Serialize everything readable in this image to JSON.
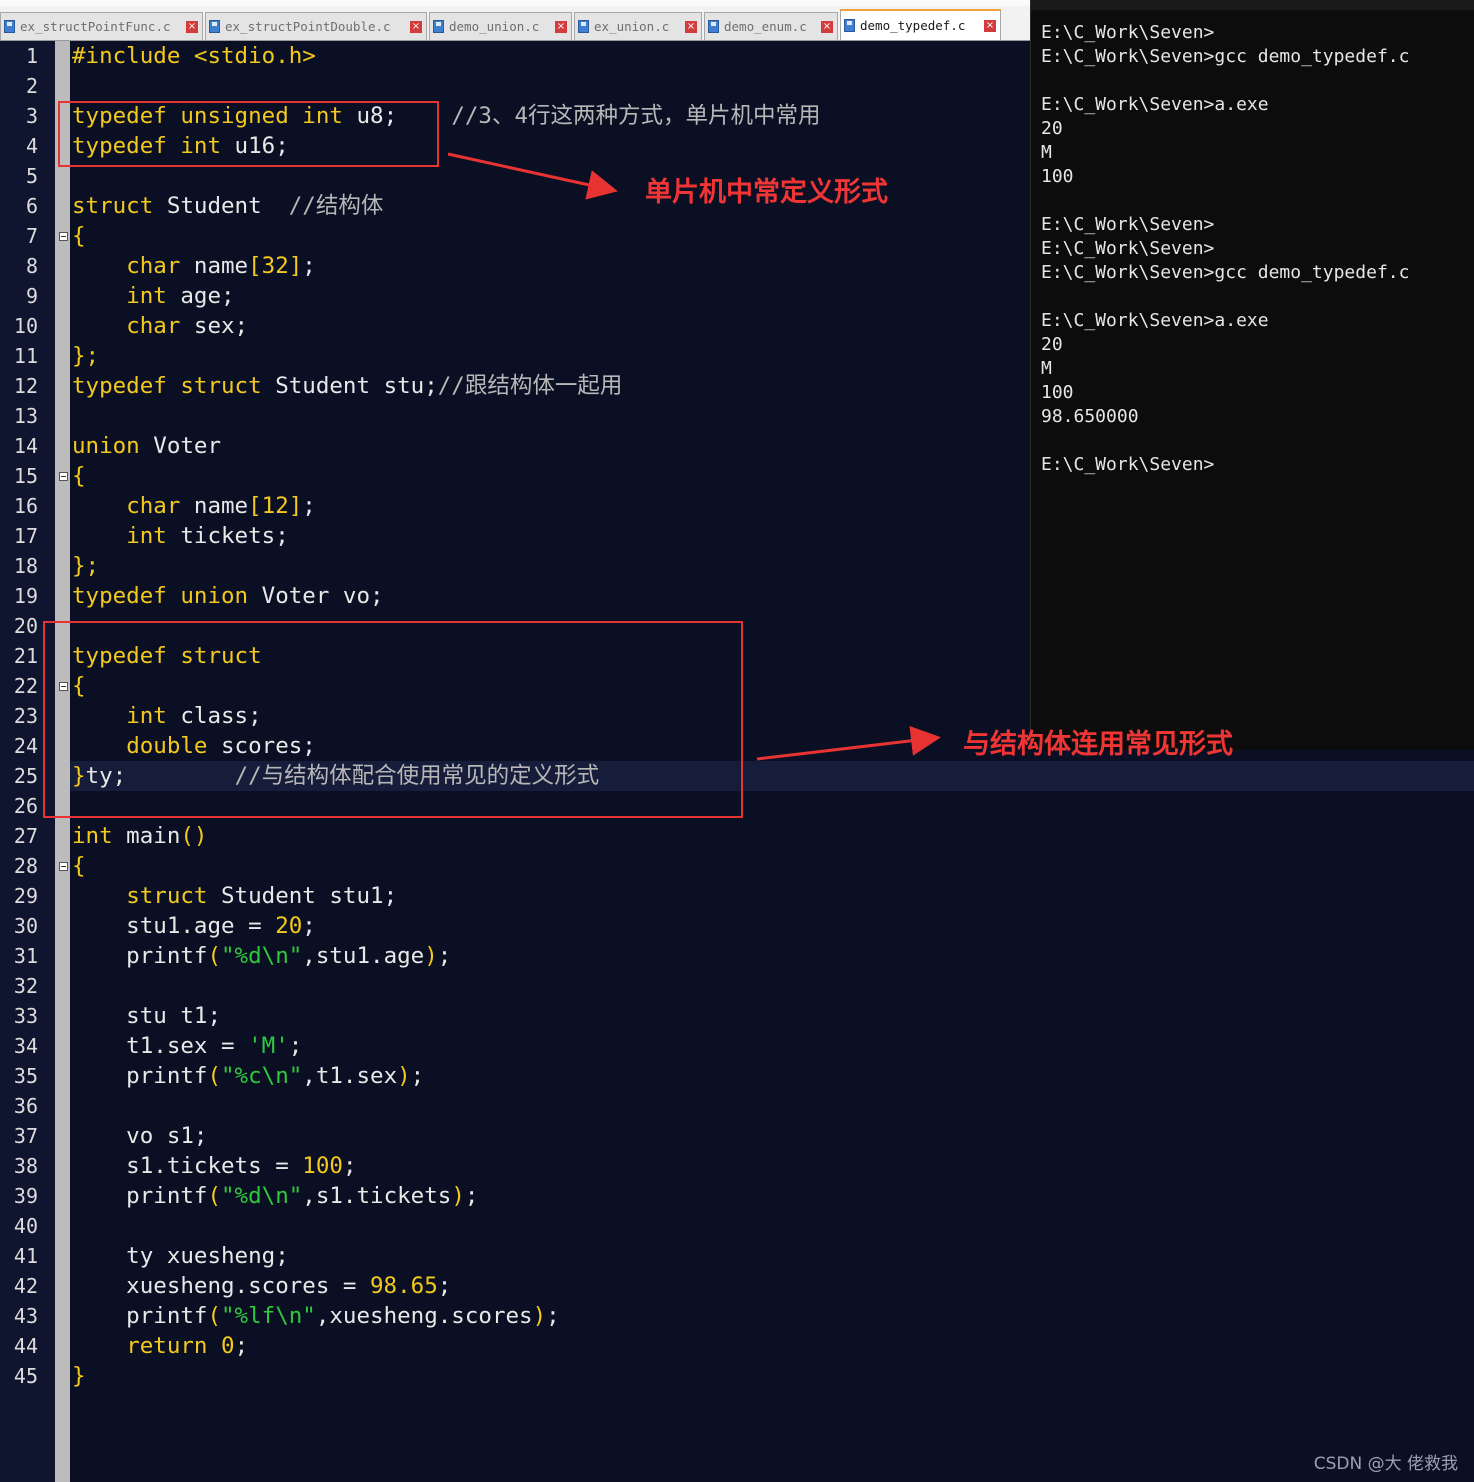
{
  "tabs": [
    {
      "label": "ex_structPointFunc.c",
      "active": false
    },
    {
      "label": "ex_structPointDouble.c",
      "active": false
    },
    {
      "label": "demo_union.c",
      "active": false
    },
    {
      "label": "ex_union.c",
      "active": false
    },
    {
      "label": "demo_enum.c",
      "active": false
    },
    {
      "label": "demo_typedef.c",
      "active": true
    }
  ],
  "code_lines": [
    [
      [
        "kw",
        "#include <stdio.h>"
      ]
    ],
    [],
    [
      [
        "kw",
        "typedef unsigned int"
      ],
      [
        "t",
        " u8;"
      ],
      [
        "t",
        "    "
      ],
      [
        "cmt",
        "//3、4行这两种方式，单片机中常用"
      ]
    ],
    [
      [
        "kw",
        "typedef int"
      ],
      [
        "t",
        " u16;"
      ]
    ],
    [],
    [
      [
        "kw",
        "struct"
      ],
      [
        "t",
        " Student  "
      ],
      [
        "cmt",
        "//结构体"
      ]
    ],
    [
      [
        "kw",
        "{"
      ]
    ],
    [
      [
        "t",
        "    "
      ],
      [
        "kw",
        "char"
      ],
      [
        "t",
        " name"
      ],
      [
        "kw",
        "[32]"
      ],
      [
        "t",
        ";"
      ]
    ],
    [
      [
        "t",
        "    "
      ],
      [
        "kw",
        "int"
      ],
      [
        "t",
        " age;"
      ]
    ],
    [
      [
        "t",
        "    "
      ],
      [
        "kw",
        "char"
      ],
      [
        "t",
        " sex;"
      ]
    ],
    [
      [
        "kw",
        "};"
      ]
    ],
    [
      [
        "kw",
        "typedef struct"
      ],
      [
        "t",
        " Student stu;"
      ],
      [
        "cmt",
        "//跟结构体一起用"
      ]
    ],
    [],
    [
      [
        "kw",
        "union"
      ],
      [
        "t",
        " Voter"
      ]
    ],
    [
      [
        "kw",
        "{"
      ]
    ],
    [
      [
        "t",
        "    "
      ],
      [
        "kw",
        "char"
      ],
      [
        "t",
        " name"
      ],
      [
        "kw",
        "[12]"
      ],
      [
        "t",
        ";"
      ]
    ],
    [
      [
        "t",
        "    "
      ],
      [
        "kw",
        "int"
      ],
      [
        "t",
        " tickets;"
      ]
    ],
    [
      [
        "kw",
        "};"
      ]
    ],
    [
      [
        "kw",
        "typedef union"
      ],
      [
        "t",
        " Voter vo;"
      ]
    ],
    [],
    [
      [
        "kw",
        "typedef struct"
      ]
    ],
    [
      [
        "kw",
        "{"
      ]
    ],
    [
      [
        "t",
        "    "
      ],
      [
        "kw",
        "int"
      ],
      [
        "t",
        " class;"
      ]
    ],
    [
      [
        "t",
        "    "
      ],
      [
        "kw",
        "double"
      ],
      [
        "t",
        " scores;"
      ]
    ],
    [
      [
        "kw",
        "}"
      ],
      [
        "t",
        "ty;        "
      ],
      [
        "cmt",
        "//与结构体配合使用常见的定义形式"
      ]
    ],
    [],
    [
      [
        "kw",
        "int"
      ],
      [
        "t",
        " main"
      ],
      [
        "kw",
        "()"
      ]
    ],
    [
      [
        "kw",
        "{"
      ]
    ],
    [
      [
        "t",
        "    "
      ],
      [
        "kw",
        "struct"
      ],
      [
        "t",
        " Student stu1;"
      ]
    ],
    [
      [
        "t",
        "    stu1.age = "
      ],
      [
        "num",
        "20"
      ],
      [
        "t",
        ";"
      ]
    ],
    [
      [
        "t",
        "    printf"
      ],
      [
        "kw",
        "("
      ],
      [
        "str",
        "\"%d\\n\""
      ],
      [
        "t",
        ",stu1.age"
      ],
      [
        "kw",
        ")"
      ],
      [
        "t",
        ";"
      ]
    ],
    [],
    [
      [
        "t",
        "    stu t1;"
      ]
    ],
    [
      [
        "t",
        "    t1.sex = "
      ],
      [
        "str",
        "'M'"
      ],
      [
        "t",
        ";"
      ]
    ],
    [
      [
        "t",
        "    printf"
      ],
      [
        "kw",
        "("
      ],
      [
        "str",
        "\"%c\\n\""
      ],
      [
        "t",
        ",t1.sex"
      ],
      [
        "kw",
        ")"
      ],
      [
        "t",
        ";"
      ]
    ],
    [],
    [
      [
        "t",
        "    vo s1;"
      ]
    ],
    [
      [
        "t",
        "    s1.tickets = "
      ],
      [
        "num",
        "100"
      ],
      [
        "t",
        ";"
      ]
    ],
    [
      [
        "t",
        "    printf"
      ],
      [
        "kw",
        "("
      ],
      [
        "str",
        "\"%d\\n\""
      ],
      [
        "t",
        ",s1.tickets"
      ],
      [
        "kw",
        ")"
      ],
      [
        "t",
        ";"
      ]
    ],
    [],
    [
      [
        "t",
        "    ty xuesheng;"
      ]
    ],
    [
      [
        "t",
        "    xuesheng.scores = "
      ],
      [
        "num",
        "98.65"
      ],
      [
        "t",
        ";"
      ]
    ],
    [
      [
        "t",
        "    printf"
      ],
      [
        "kw",
        "("
      ],
      [
        "str",
        "\"%lf\\n\""
      ],
      [
        "t",
        ",xuesheng.scores"
      ],
      [
        "kw",
        ")"
      ],
      [
        "t",
        ";"
      ]
    ],
    [
      [
        "t",
        "    "
      ],
      [
        "kw",
        "return"
      ],
      [
        "t",
        " "
      ],
      [
        "num",
        "0"
      ],
      [
        "t",
        ";"
      ]
    ],
    [
      [
        "kw",
        "}"
      ]
    ]
  ],
  "fold_lines": [
    7,
    15,
    22,
    28
  ],
  "terminal_lines": [
    "E:\\C_Work\\Seven>",
    "E:\\C_Work\\Seven>gcc demo_typedef.c",
    "",
    "E:\\C_Work\\Seven>a.exe",
    "20",
    "M",
    "100",
    "",
    "E:\\C_Work\\Seven>",
    "E:\\C_Work\\Seven>",
    "E:\\C_Work\\Seven>gcc demo_typedef.c",
    "",
    "E:\\C_Work\\Seven>a.exe",
    "20",
    "M",
    "100",
    "98.650000",
    "",
    "E:\\C_Work\\Seven>"
  ],
  "annotations": {
    "note1": "单片机中常定义形式",
    "note2": "与结构体连用常见形式"
  },
  "watermark": "CSDN @大 佬救我",
  "colors": {
    "editor_bg": "#0b0f24",
    "keyword": "#f2c91c",
    "string": "#2fc83c",
    "comment": "#b7b7b7",
    "annotation_red": "#e83333"
  }
}
